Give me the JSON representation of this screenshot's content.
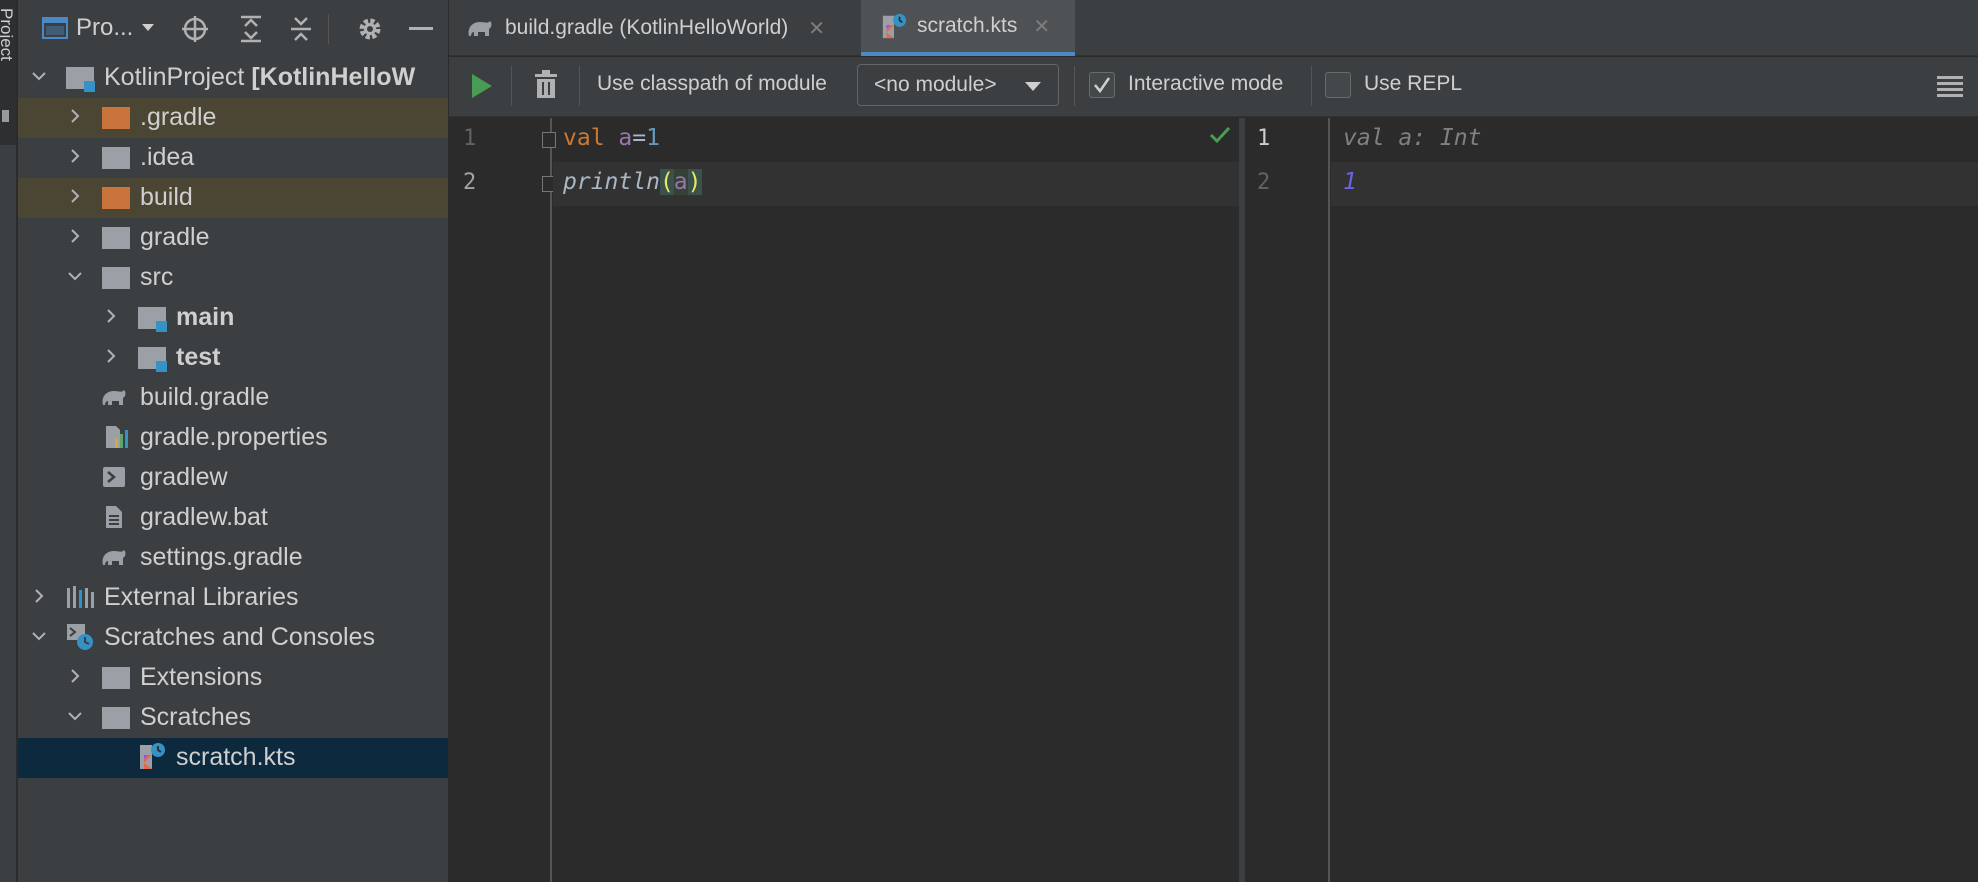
{
  "side_strip": {
    "tab_label": "Project"
  },
  "project_panel": {
    "title": "Pro...",
    "tree": [
      {
        "label": "KotlinProject",
        "suffix": "[KotlinHelloW",
        "depth": 0,
        "expanded": true,
        "icon": "module-folder-icon"
      },
      {
        "label": ".gradle",
        "depth": 1,
        "expanded": false,
        "icon": "folder-excluded-icon"
      },
      {
        "label": ".idea",
        "depth": 1,
        "expanded": false,
        "icon": "folder-icon"
      },
      {
        "label": "build",
        "depth": 1,
        "expanded": false,
        "icon": "folder-excluded-icon"
      },
      {
        "label": "gradle",
        "depth": 1,
        "expanded": false,
        "icon": "folder-icon"
      },
      {
        "label": "src",
        "depth": 1,
        "expanded": true,
        "icon": "folder-icon"
      },
      {
        "label": "main",
        "depth": 2,
        "expanded": false,
        "icon": "source-folder-icon"
      },
      {
        "label": "test",
        "depth": 2,
        "expanded": false,
        "icon": "source-folder-icon"
      },
      {
        "label": "build.gradle",
        "depth": 1,
        "icon": "gradle-elephant-icon"
      },
      {
        "label": "gradle.properties",
        "depth": 1,
        "icon": "properties-file-icon"
      },
      {
        "label": "gradlew",
        "depth": 1,
        "icon": "shell-script-icon"
      },
      {
        "label": "gradlew.bat",
        "depth": 1,
        "icon": "text-file-icon"
      },
      {
        "label": "settings.gradle",
        "depth": 1,
        "icon": "gradle-elephant-icon"
      },
      {
        "label": "External Libraries",
        "depth": 0,
        "expanded": false,
        "icon": "library-icon"
      },
      {
        "label": "Scratches and Consoles",
        "depth": 0,
        "expanded": true,
        "icon": "scratches-icon"
      },
      {
        "label": "Extensions",
        "depth": 1,
        "expanded": false,
        "icon": "folder-icon"
      },
      {
        "label": "Scratches",
        "depth": 1,
        "expanded": true,
        "icon": "folder-icon"
      },
      {
        "label": "scratch.kts",
        "depth": 2,
        "icon": "kotlin-script-icon",
        "selected": true
      }
    ]
  },
  "tabs": [
    {
      "label": "build.gradle (KotlinHelloWorld)",
      "active": false
    },
    {
      "label": "scratch.kts",
      "active": true
    }
  ],
  "toolbar": {
    "classpath_label": "Use classpath of module",
    "module_value": "<no module>",
    "interactive_label": "Interactive mode",
    "interactive_checked": true,
    "repl_label": "Use REPL",
    "repl_checked": false
  },
  "editor": {
    "line_numbers": [
      "1",
      "2"
    ],
    "lines": [
      {
        "kw": "val",
        "name": "a",
        "op": "=",
        "num": "1"
      },
      {
        "fn": "println",
        "open": "(",
        "arg": "a",
        "close": ")"
      }
    ]
  },
  "output": {
    "line_numbers": [
      "1",
      "2"
    ],
    "lines": [
      "val a: Int",
      "1"
    ]
  },
  "colors": {
    "accent": "#4a88c7",
    "excluded_folder": "#c8743c",
    "success": "#499c54",
    "output_value": "#6a63e6"
  }
}
